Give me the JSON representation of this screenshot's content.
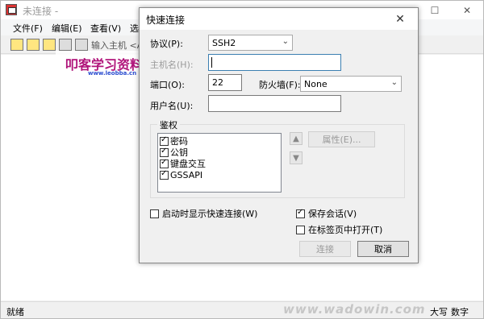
{
  "main_window": {
    "title": "未连接 -",
    "min_glyph": "—",
    "max_glyph": "☐",
    "close_glyph": "✕",
    "menu": [
      "文件(F)",
      "编辑(E)",
      "查看(V)",
      "选项"
    ],
    "toolbar_host_text": "输入主机 <Al",
    "watermark_title": "叩客学习资料网",
    "watermark_url": "www.leobba.cn",
    "status_text": "就绪",
    "status_caps": "大写",
    "status_num": "数字",
    "site_watermark": "www.wadowin.com"
  },
  "dialog": {
    "title": "快速连接",
    "close_glyph": "✕",
    "protocol_label": "协议(P):",
    "protocol_value": "SSH2",
    "hostname_label": "主机名(H):",
    "hostname_value": "",
    "port_label": "端口(O):",
    "port_value": "22",
    "firewall_label": "防火墙(F):",
    "firewall_value": "None",
    "username_label": "用户名(U):",
    "username_value": "",
    "auth_legend": "鉴权",
    "auth_methods": [
      {
        "label": "密码",
        "checked": true
      },
      {
        "label": "公钥",
        "checked": true
      },
      {
        "label": "键盘交互",
        "checked": true
      },
      {
        "label": "GSSAPI",
        "checked": true
      }
    ],
    "up_glyph": "▲",
    "down_glyph": "▼",
    "properties_label": "属性(E)...",
    "show_on_startup_label": "启动时显示快速连接(W)",
    "show_on_startup_checked": false,
    "save_session_label": "保存会话(V)",
    "save_session_checked": true,
    "open_in_tab_label": "在标签页中打开(T)",
    "open_in_tab_checked": false,
    "connect_label": "连接",
    "cancel_label": "取消",
    "dropdown_arrow": "⌄"
  }
}
